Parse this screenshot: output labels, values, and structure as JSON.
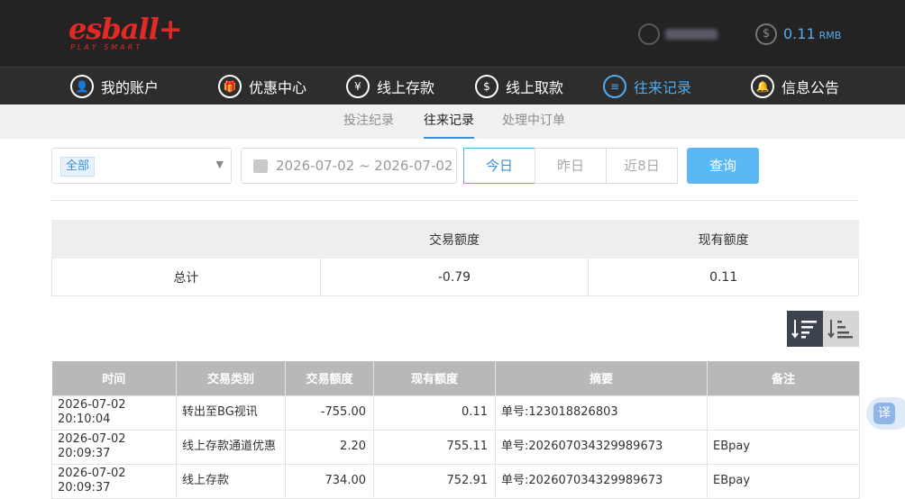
{
  "brand": {
    "logo": "esball+",
    "tagline": "PLAY SMART"
  },
  "account": {
    "balance": "0.11",
    "currency": "RMB"
  },
  "mainnav": [
    {
      "label": "我的账户",
      "icon": "user-icon"
    },
    {
      "label": "优惠中心",
      "icon": "gift-icon"
    },
    {
      "label": "线上存款",
      "icon": "deposit-icon"
    },
    {
      "label": "线上取款",
      "icon": "withdraw-icon"
    },
    {
      "label": "往来记录",
      "icon": "records-icon"
    },
    {
      "label": "信息公告",
      "icon": "bell-icon"
    }
  ],
  "subnav": [
    {
      "label": "投注纪录"
    },
    {
      "label": "往来记录"
    },
    {
      "label": "处理中订单"
    }
  ],
  "filters": {
    "type_selected": "全部",
    "date_range": "2026-07-02 ~ 2026-07-02",
    "ranges": [
      "今日",
      "昨日",
      "近8日"
    ],
    "query_label": "查询"
  },
  "summary": {
    "headers": [
      "",
      "交易额度",
      "现有额度"
    ],
    "row": [
      "总计",
      "-0.79",
      "0.11"
    ]
  },
  "records": {
    "headers": [
      "时间",
      "交易类别",
      "交易额度",
      "现有额度",
      "摘要",
      "备注"
    ],
    "rows": [
      [
        "2026-07-02 20:10:04",
        "转出至BG视讯",
        "-755.00",
        "0.11",
        "单号:123018826803",
        ""
      ],
      [
        "2026-07-02 20:09:37",
        "线上存款通道优惠",
        "2.20",
        "755.11",
        "单号:202607034329989673",
        "EBpay"
      ],
      [
        "2026-07-02 20:09:37",
        "线上存款",
        "734.00",
        "752.91",
        "单号:202607034329989673",
        "EBpay"
      ]
    ]
  },
  "translate_label": "译",
  "colors": {
    "accent": "#54a9ea",
    "brand_red": "#e12a26",
    "header_bg": "#232323",
    "query_btn": "#5cb8f5"
  }
}
